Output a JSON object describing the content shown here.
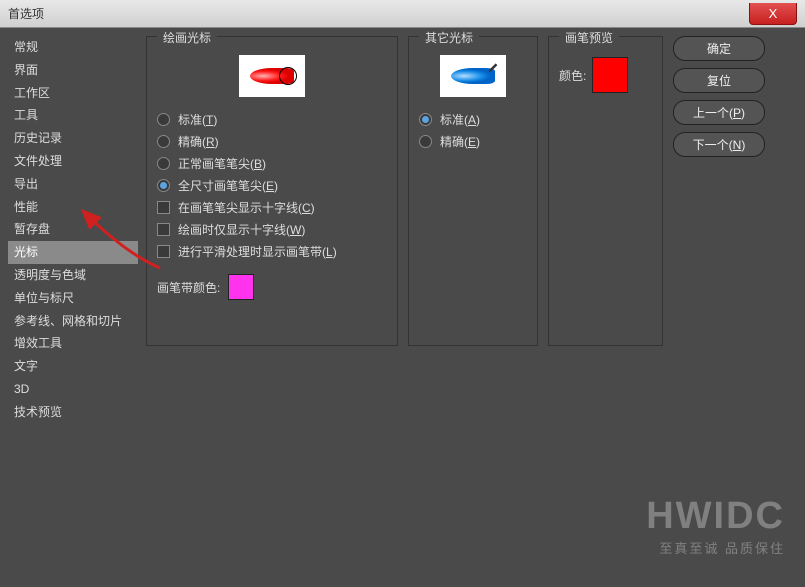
{
  "window": {
    "title": "首选项",
    "close": "X"
  },
  "sidebar": {
    "items": [
      {
        "label": "常规",
        "active": false
      },
      {
        "label": "界面",
        "active": false
      },
      {
        "label": "工作区",
        "active": false
      },
      {
        "label": "工具",
        "active": false
      },
      {
        "label": "历史记录",
        "active": false
      },
      {
        "label": "文件处理",
        "active": false
      },
      {
        "label": "导出",
        "active": false
      },
      {
        "label": "性能",
        "active": false
      },
      {
        "label": "暂存盘",
        "active": false
      },
      {
        "label": "光标",
        "active": true
      },
      {
        "label": "透明度与色域",
        "active": false
      },
      {
        "label": "单位与标尺",
        "active": false
      },
      {
        "label": "参考线、网格和切片",
        "active": false
      },
      {
        "label": "增效工具",
        "active": false
      },
      {
        "label": "文字",
        "active": false
      },
      {
        "label": "3D",
        "active": false
      },
      {
        "label": "技术预览",
        "active": false
      }
    ]
  },
  "panels": {
    "paint": {
      "title": "绘画光标",
      "radios": {
        "standard": {
          "label": "标准(",
          "key": "T",
          "suffix": ")",
          "checked": false
        },
        "precise": {
          "label": "精确(",
          "key": "R",
          "suffix": ")",
          "checked": false
        },
        "normal_tip": {
          "label": "正常画笔笔尖(",
          "key": "B",
          "suffix": ")",
          "checked": false
        },
        "full_tip": {
          "label": "全尺寸画笔笔尖(",
          "key": "E",
          "suffix": ")",
          "checked": true
        }
      },
      "checks": {
        "crosshair": {
          "label": "在画笔笔尖显示十字线(",
          "key": "C",
          "suffix": ")",
          "checked": false
        },
        "only_cross": {
          "label": "绘画时仅显示十字线(",
          "key": "W",
          "suffix": ")",
          "checked": false
        },
        "smooth": {
          "label": "进行平滑处理时显示画笔带(",
          "key": "L",
          "suffix": ")",
          "checked": false
        }
      },
      "leash_label": "画笔带颜色:",
      "leash_color": "#ff33ee"
    },
    "other": {
      "title": "其它光标",
      "radios": {
        "standard": {
          "label": "标准(",
          "key": "A",
          "suffix": ")",
          "checked": true
        },
        "precise": {
          "label": "精确(",
          "key": "E",
          "suffix": ")",
          "checked": false
        }
      }
    },
    "preview": {
      "title": "画笔预览",
      "color_label": "颜色:",
      "color": "#ff0000"
    }
  },
  "buttons": {
    "ok": "确定",
    "cancel": "复位",
    "prev": {
      "label": "上一个(",
      "key": "P",
      "suffix": ")"
    },
    "next": {
      "label": "下一个(",
      "key": "N",
      "suffix": ")"
    }
  },
  "watermark": {
    "big": "HWIDC",
    "small": "至真至诚 品质保住"
  }
}
